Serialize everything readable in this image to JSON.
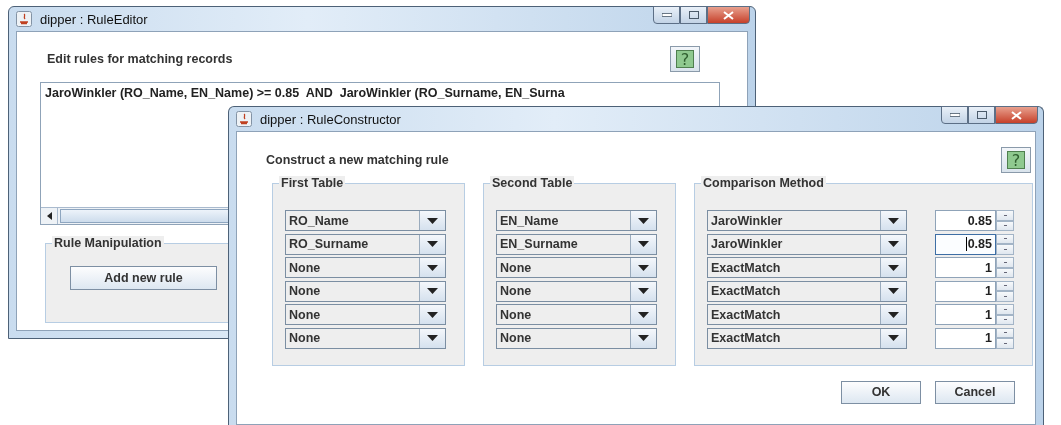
{
  "windows": [
    {
      "kind": "editor",
      "title": "dipper : RuleEditor",
      "heading": "Edit rules for matching records",
      "help_button": "?",
      "rules_text": "JaroWinkler (RO_Name, EN_Name) >= 0.85  AND  JaroWinkler (RO_Surname, EN_Surna",
      "group": {
        "title": "Rule Manipulation",
        "button": "Add new rule"
      }
    },
    {
      "kind": "constructor",
      "title": "dipper : RuleConstructor",
      "heading": "Construct a new matching rule",
      "help_button": "?",
      "first_table": {
        "title": "First Table",
        "rows": [
          "RO_Name",
          "RO_Surname",
          "None",
          "None",
          "None",
          "None"
        ]
      },
      "second_table": {
        "title": "Second Table",
        "rows": [
          "EN_Name",
          "EN_Surname",
          "None",
          "None",
          "None",
          "None"
        ]
      },
      "comparison": {
        "title": "Comparison Method",
        "rows": [
          {
            "method": "JaroWinkler",
            "threshold": "0.85",
            "focused": false
          },
          {
            "method": "JaroWinkler",
            "threshold": "0.85",
            "focused": true
          },
          {
            "method": "ExactMatch",
            "threshold": "1",
            "focused": false
          },
          {
            "method": "ExactMatch",
            "threshold": "1",
            "focused": false
          },
          {
            "method": "ExactMatch",
            "threshold": "1",
            "focused": false
          },
          {
            "method": "ExactMatch",
            "threshold": "1",
            "focused": false
          }
        ]
      },
      "buttons": [
        "OK",
        "Cancel"
      ]
    }
  ]
}
